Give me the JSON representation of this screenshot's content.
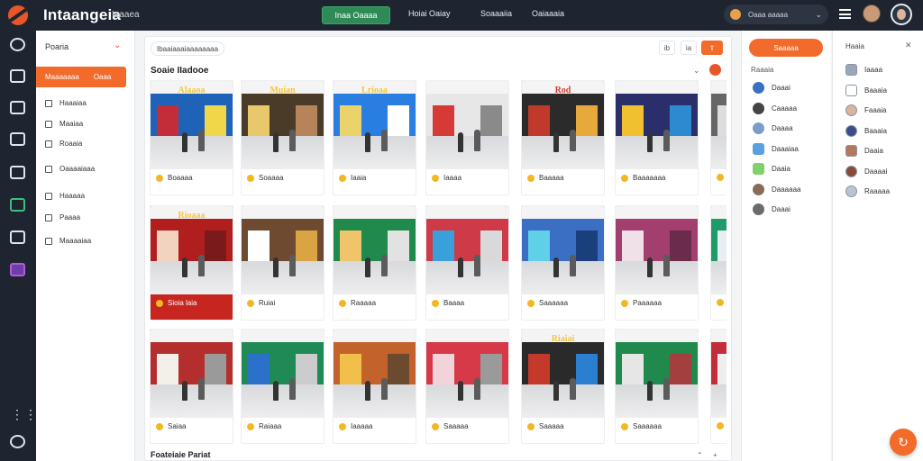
{
  "topbar": {
    "brand": "Intaangeia",
    "brand_sub": "Iaaaea",
    "primary_button": "Inaa Oaaaa",
    "links": [
      "Hoiai  Oaiay",
      "Soaaaiia",
      "Oaiaaaia"
    ],
    "search_text": "Oaaa aaaaa"
  },
  "nav": {
    "header": "Poaria",
    "active_item": "Maaaaaaa",
    "active_tag": "Oaaa",
    "items": [
      "Haaaiaa",
      "Maaiaa",
      "Roaaia",
      "Oaaaaiaaa",
      "Haaaaa",
      "Paaaa",
      "Maaaaiaa"
    ]
  },
  "main": {
    "breadcrumb": "Ibaaiaaaiaaaaaaaa",
    "tools": [
      "ib",
      "ia"
    ],
    "section_title": "Soaie IIadooe",
    "sub_title": "Foateiaie Pariat",
    "cards": [
      {
        "sign": "Alaaoa",
        "label": "Boaaaa"
      },
      {
        "sign": "Muian",
        "label": "Soaaaa"
      },
      {
        "sign": "Lrioaa",
        "label": "Iaaia"
      },
      {
        "sign": "",
        "label": "Iaaaa"
      },
      {
        "sign": "Rod",
        "label": "Baaaaa"
      },
      {
        "sign": "",
        "label": "Baaaaaaa"
      },
      {
        "sign": "",
        "label": ""
      },
      {
        "sign": "Rioaaa",
        "label": "Sioia laia"
      },
      {
        "sign": "",
        "label": "Ruiai"
      },
      {
        "sign": "",
        "label": "Raaaaa"
      },
      {
        "sign": "",
        "label": "Baaaa"
      },
      {
        "sign": "",
        "label": "Saaaaaa"
      },
      {
        "sign": "",
        "label": "Paaaaaa"
      },
      {
        "sign": "",
        "label": ""
      },
      {
        "sign": "",
        "label": "Saiaa"
      },
      {
        "sign": "",
        "label": "Raiaaa"
      },
      {
        "sign": "",
        "label": "Iaaaaa"
      },
      {
        "sign": "",
        "label": "Saaaaa"
      },
      {
        "sign": "Riaiai",
        "label": "Saaaaa"
      },
      {
        "sign": "",
        "label": "Saaaaaa"
      },
      {
        "sign": "",
        "label": ""
      }
    ]
  },
  "right_panel": {
    "cta": "Saaaaa",
    "label": "Raaaia",
    "items": [
      "Daaai",
      "Caaaaa",
      "Daaaa",
      "Daaaiaa",
      "Daaia",
      "Daaaaaa",
      "Daaai"
    ]
  },
  "right_panel2": {
    "label": "Haaia",
    "items": [
      "Iaaaa",
      "Baaaia",
      "Faaaia",
      "Baaaia",
      "Daaia",
      "Daaaai",
      "Raaaaa"
    ]
  },
  "colors": {
    "accent": "#f26b2a",
    "topbar_bg": "#1e2530",
    "primary_green": "#2e8b57"
  }
}
